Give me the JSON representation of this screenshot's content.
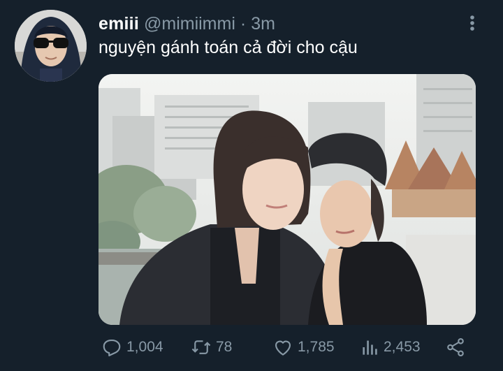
{
  "tweet": {
    "author_name": "emiii",
    "author_handle": "@mimiimmi",
    "separator": "·",
    "time": "3m",
    "text": "nguyện gánh toán cả đời cho cậu"
  },
  "actions": {
    "replies": "1,004",
    "retweets": "78",
    "likes": "1,785",
    "views": "2,453"
  },
  "icons": {
    "reply": "reply-icon",
    "retweet": "retweet-icon",
    "like": "like-icon",
    "views": "views-icon",
    "share": "share-icon",
    "more": "more-icon"
  },
  "colors": {
    "background": "#15202b",
    "text": "#ffffff",
    "secondary": "#8899a6"
  }
}
